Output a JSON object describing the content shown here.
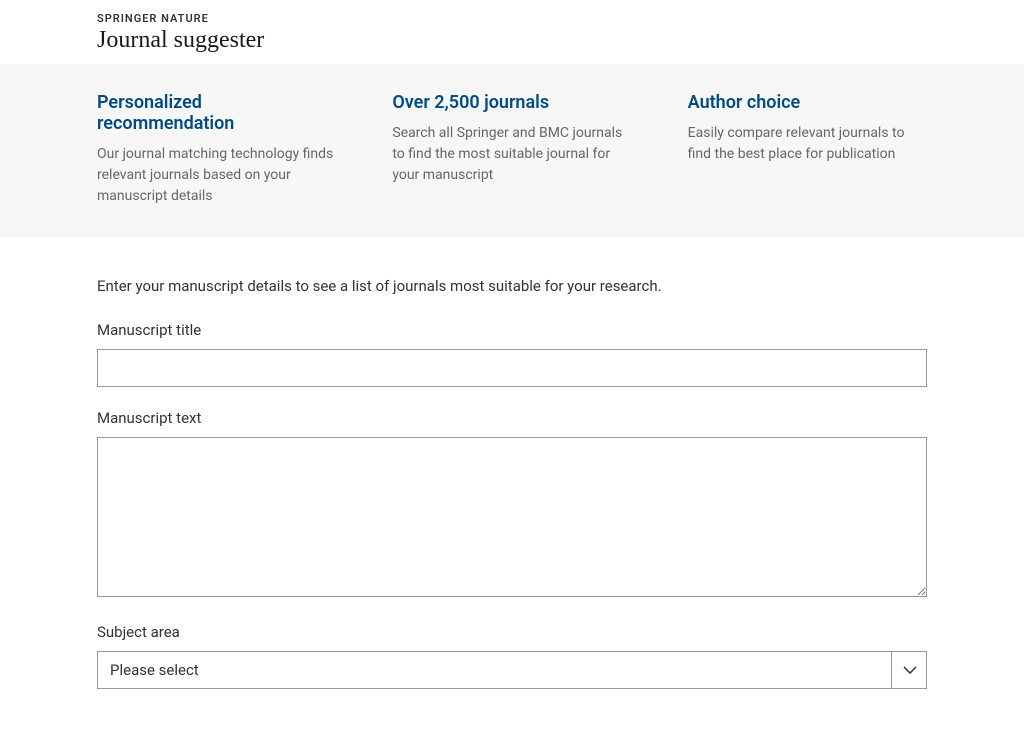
{
  "header": {
    "brand": "SPRINGER NATURE",
    "product": "Journal suggester"
  },
  "features": [
    {
      "title": "Personalized recommendation",
      "desc": "Our journal matching technology finds relevant journals based on your manuscript details"
    },
    {
      "title": "Over 2,500 journals",
      "desc": "Search all Springer and BMC journals to find the most suitable journal for your manuscript"
    },
    {
      "title": "Author choice",
      "desc": "Easily compare relevant journals to find the best place for publication"
    }
  ],
  "form": {
    "intro": "Enter your manuscript details to see a list of journals most suitable for your research.",
    "title_label": "Manuscript title",
    "title_value": "",
    "text_label": "Manuscript text",
    "text_value": "",
    "subject_label": "Subject area",
    "subject_placeholder": "Please select"
  }
}
